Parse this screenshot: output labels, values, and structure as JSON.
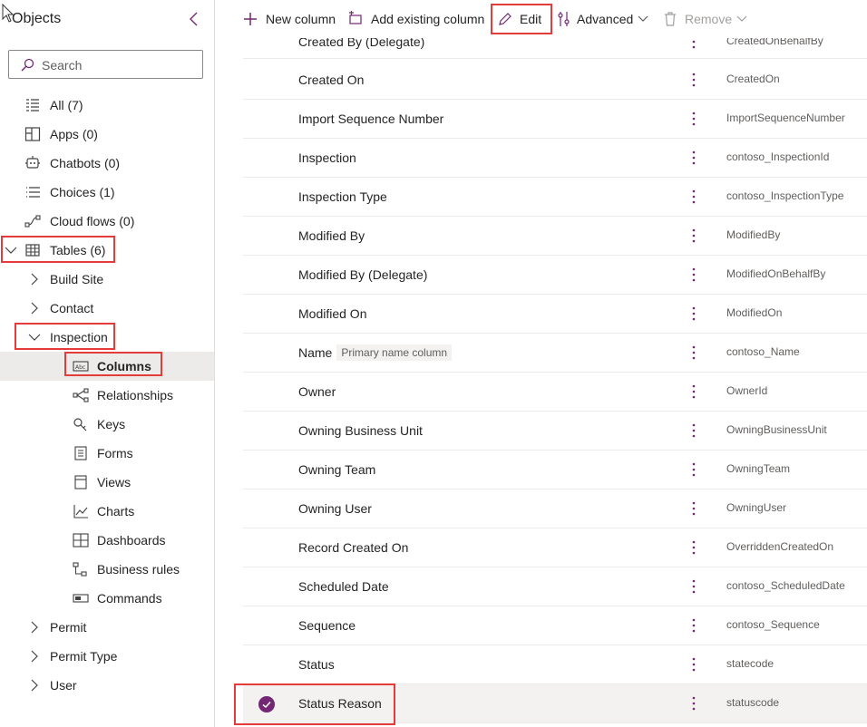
{
  "sidebar": {
    "title": "Objects",
    "search_placeholder": "Search",
    "items": [
      {
        "label": "All",
        "count": "(7)"
      },
      {
        "label": "Apps",
        "count": "(0)"
      },
      {
        "label": "Chatbots",
        "count": "(0)"
      },
      {
        "label": "Choices",
        "count": "(1)"
      },
      {
        "label": "Cloud flows",
        "count": "(0)"
      },
      {
        "label": "Tables",
        "count": "(6)"
      }
    ],
    "tables": [
      "Build Site",
      "Contact",
      "Inspection",
      "Permit",
      "Permit Type",
      "User"
    ],
    "inspection_children": [
      "Columns",
      "Relationships",
      "Keys",
      "Forms",
      "Views",
      "Charts",
      "Dashboards",
      "Business rules",
      "Commands"
    ]
  },
  "toolbar": {
    "new_column": "New column",
    "add_existing": "Add existing column",
    "edit": "Edit",
    "advanced": "Advanced",
    "remove": "Remove"
  },
  "columns": [
    {
      "display": "Created By (Delegate)",
      "logical": "CreatedOnBehalfBy"
    },
    {
      "display": "Created On",
      "logical": "CreatedOn"
    },
    {
      "display": "Import Sequence Number",
      "logical": "ImportSequenceNumber"
    },
    {
      "display": "Inspection",
      "logical": "contoso_InspectionId"
    },
    {
      "display": "Inspection Type",
      "logical": "contoso_InspectionType"
    },
    {
      "display": "Modified By",
      "logical": "ModifiedBy"
    },
    {
      "display": "Modified By (Delegate)",
      "logical": "ModifiedOnBehalfBy"
    },
    {
      "display": "Modified On",
      "logical": "ModifiedOn"
    },
    {
      "display": "Name",
      "logical": "contoso_Name",
      "badge": "Primary name column"
    },
    {
      "display": "Owner",
      "logical": "OwnerId"
    },
    {
      "display": "Owning Business Unit",
      "logical": "OwningBusinessUnit"
    },
    {
      "display": "Owning Team",
      "logical": "OwningTeam"
    },
    {
      "display": "Owning User",
      "logical": "OwningUser"
    },
    {
      "display": "Record Created On",
      "logical": "OverriddenCreatedOn"
    },
    {
      "display": "Scheduled Date",
      "logical": "contoso_ScheduledDate"
    },
    {
      "display": "Sequence",
      "logical": "contoso_Sequence"
    },
    {
      "display": "Status",
      "logical": "statecode"
    },
    {
      "display": "Status Reason",
      "logical": "statuscode"
    }
  ],
  "colors": {
    "accent": "#742774",
    "highlight": "#e53b3b"
  }
}
